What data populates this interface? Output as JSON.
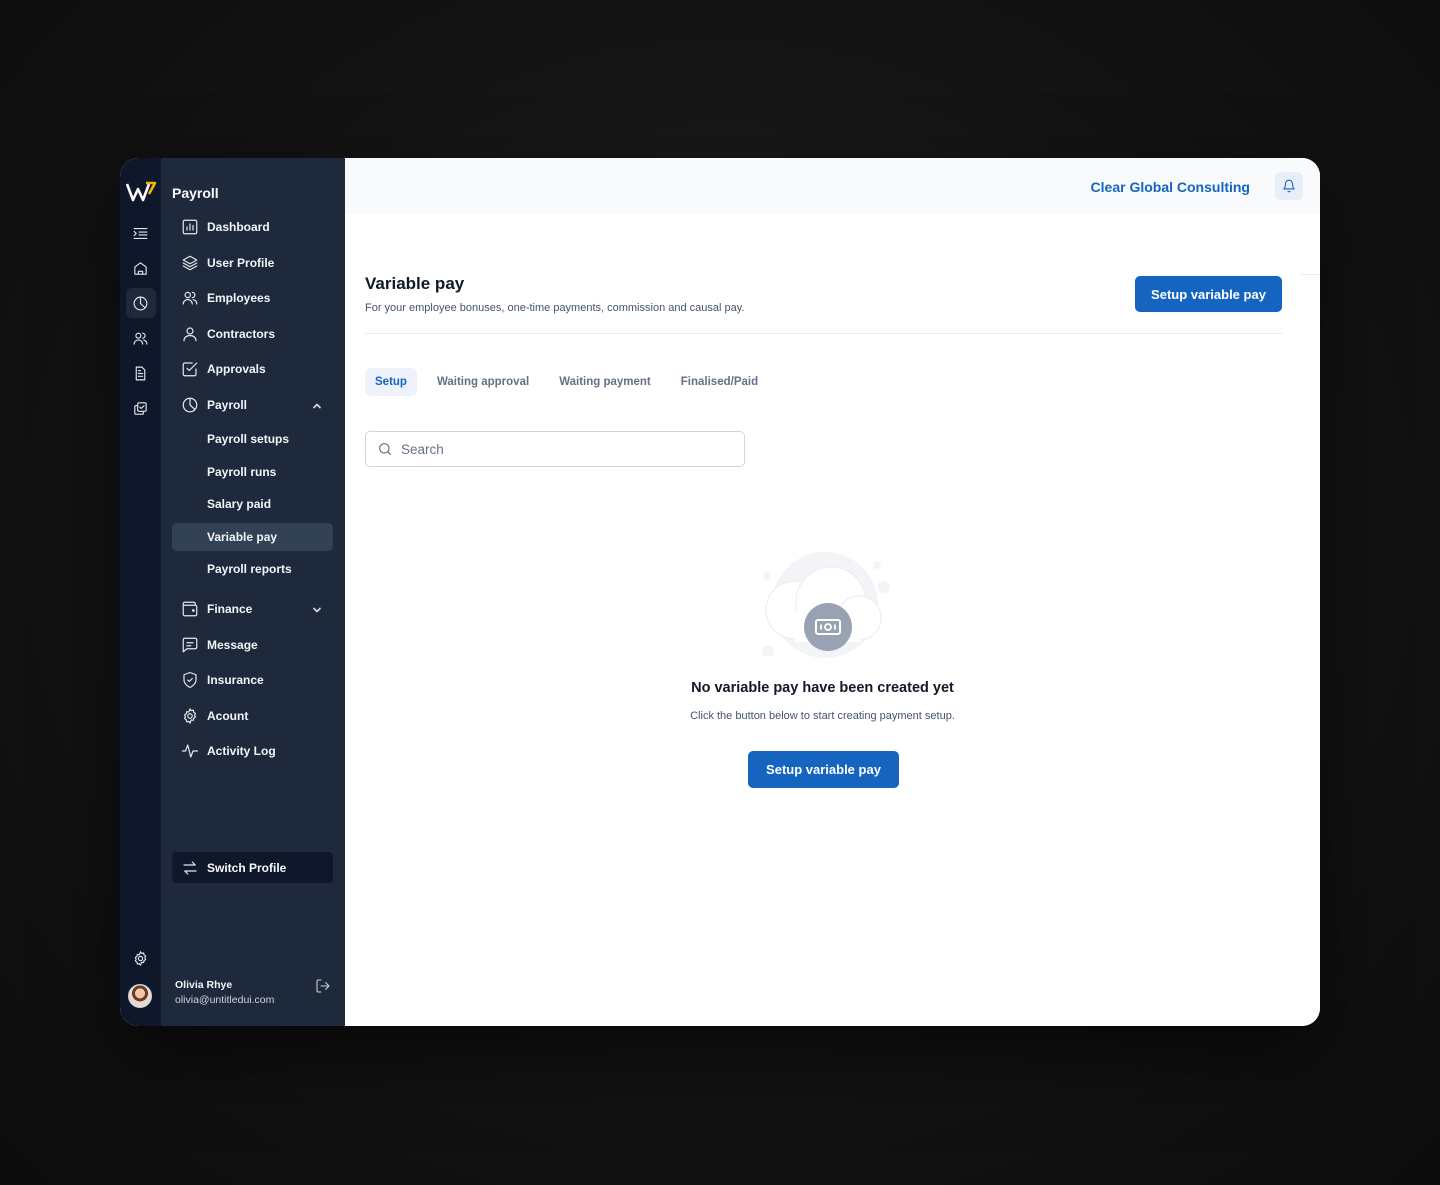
{
  "sidebar": {
    "title": "Payroll",
    "items": [
      {
        "label": "Dashboard",
        "icon": "bar-chart-icon"
      },
      {
        "label": "User Profile",
        "icon": "layers-icon"
      },
      {
        "label": "Employees",
        "icon": "users-icon"
      },
      {
        "label": "Contractors",
        "icon": "user-icon"
      },
      {
        "label": "Approvals",
        "icon": "check-square-icon"
      },
      {
        "label": "Payroll",
        "icon": "pie-chart-icon",
        "expanded": true
      }
    ],
    "payroll_sub": [
      "Payroll setups",
      "Payroll runs",
      "Salary paid",
      "Variable pay",
      "Payroll reports"
    ],
    "active_sub": "Variable pay",
    "items2": [
      {
        "label": "Finance",
        "icon": "wallet-icon"
      },
      {
        "label": "Message",
        "icon": "message-icon"
      },
      {
        "label": "Insurance",
        "icon": "shield-icon"
      },
      {
        "label": "Acount",
        "icon": "gear-icon"
      },
      {
        "label": "Activity Log",
        "icon": "activity-icon"
      }
    ],
    "switch_profile": "Switch Profile",
    "user": {
      "name": "Olivia Rhye",
      "email": "olivia@untitledui.com"
    }
  },
  "topbar": {
    "company": "Clear Global Consulting"
  },
  "page": {
    "title": "Variable pay",
    "subtitle": "For your employee bonuses, one-time payments, commission and causal pay.",
    "header_button": "Setup variable pay",
    "tabs": [
      "Setup",
      "Waiting approval",
      "Waiting payment",
      "Finalised/Paid"
    ],
    "active_tab": "Setup",
    "search_placeholder": "Search",
    "empty": {
      "title": "No variable pay have been created yet",
      "subtitle": "Click the button below to start creating payment setup.",
      "button": "Setup variable pay"
    }
  },
  "colors": {
    "primary": "#1565c0",
    "sidebar": "#1e293b",
    "rail": "#0f172a"
  }
}
